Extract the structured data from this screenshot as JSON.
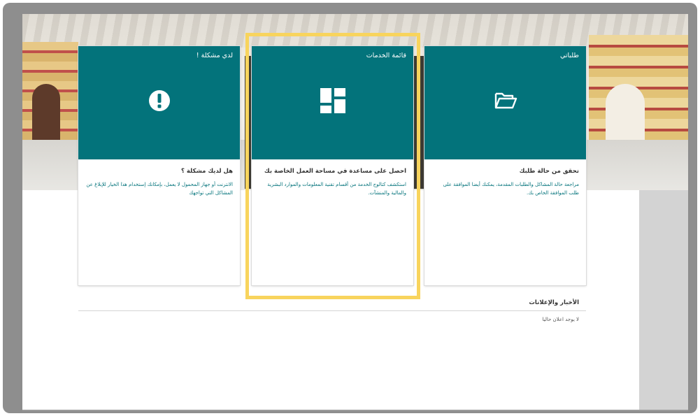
{
  "cards": {
    "requests": {
      "title": "طلباتي",
      "icon": "folder-open-icon",
      "subtitle": "تحقق من حالة طلبك",
      "description": "مراجعة حالة المشاكل والطلبات المقدمة، يمكنك أيضا الموافقة على طلب الموافقة الخاص بك."
    },
    "services": {
      "title": "قائمة الخدمات",
      "icon": "dashboard-grid-icon",
      "subtitle": "احصل على مساعدة في مساحة العمل الخاصة بك",
      "description": "استكشف كتالوج الخدمة من أقسام تقنية المعلومات والموارد البشرية والمالية والمنشآت."
    },
    "problem": {
      "title": "لدي مشكلة !",
      "icon": "exclamation-circle-icon",
      "subtitle": "هل لديك مشكلة ؟",
      "description": "الانترنت أو جهاز المحمول لا يعمل، بإمكانك إستخدام هذا الخيار للإبلاغ عن المشاكل التي تواجهك"
    }
  },
  "news": {
    "heading": "الأخبار والإعلانات",
    "empty_text": "لا يوجد اعلان حاليا"
  },
  "colors": {
    "card_header": "#03737b",
    "highlight": "#f8d45d",
    "frame": "#8e8e8e"
  }
}
